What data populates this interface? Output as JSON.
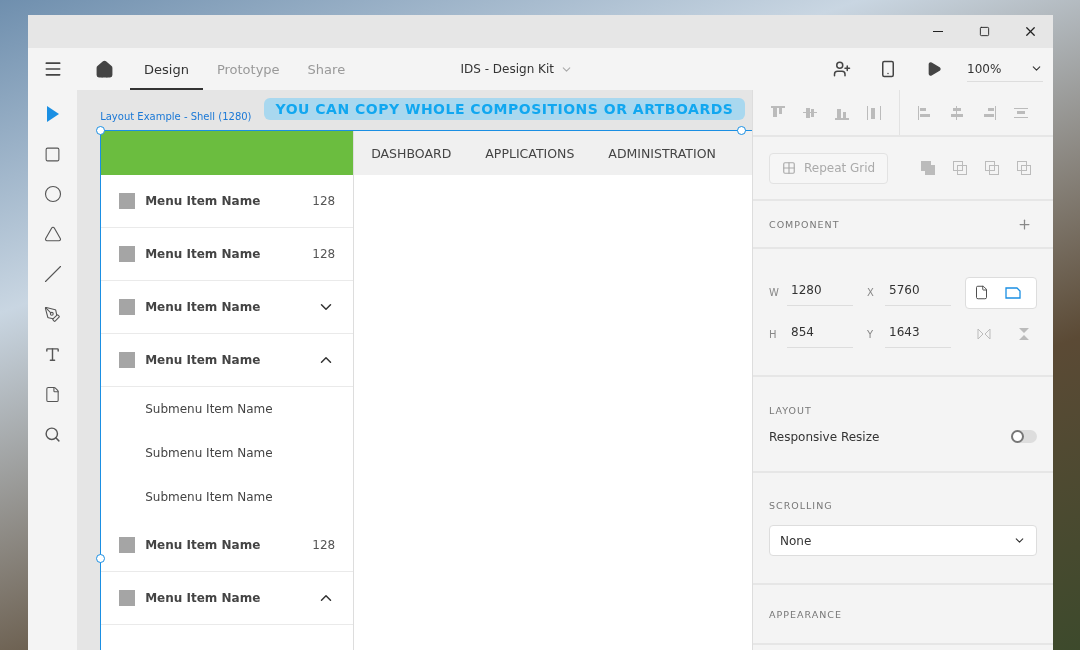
{
  "toolbar": {
    "tabs": [
      {
        "label": "Design",
        "selected": true
      },
      {
        "label": "Prototype",
        "selected": false
      },
      {
        "label": "Share",
        "selected": false
      }
    ],
    "document_title": "IDS - Design Kit",
    "zoom": "100%"
  },
  "tools": [
    {
      "kind": "select",
      "selected": true
    },
    {
      "kind": "rectangle",
      "selected": false
    },
    {
      "kind": "ellipse",
      "selected": false
    },
    {
      "kind": "polygon",
      "selected": false
    },
    {
      "kind": "line",
      "selected": false
    },
    {
      "kind": "pen",
      "selected": false
    },
    {
      "kind": "text",
      "selected": false
    },
    {
      "kind": "artboard",
      "selected": false
    },
    {
      "kind": "zoom",
      "selected": false
    }
  ],
  "canvas": {
    "artboard_label": "Layout Example - Shell (1280)",
    "banner": "YOU CAN COPY WHOLE COMPOSITIONS OR ARTBOARDS",
    "nav": [
      "DASHBOARD",
      "APPLICATIONS",
      "ADMINISTRATION"
    ],
    "menu": [
      {
        "label": "Menu Item Name",
        "kind": "count",
        "count": "128"
      },
      {
        "label": "Menu Item Name",
        "kind": "count",
        "count": "128"
      },
      {
        "label": "Menu Item Name",
        "kind": "expandable",
        "expanded": false
      },
      {
        "label": "Menu Item Name",
        "kind": "expandable",
        "expanded": true,
        "children": [
          {
            "label": "Submenu Item Name"
          },
          {
            "label": "Submenu Item Name"
          },
          {
            "label": "Submenu Item Name"
          }
        ]
      },
      {
        "label": "Menu Item Name",
        "kind": "count",
        "count": "128"
      },
      {
        "label": "Menu Item Name",
        "kind": "expandable",
        "expanded": true
      }
    ]
  },
  "panel": {
    "repeat_grid": "Repeat Grid",
    "component": "COMPONENT",
    "fields": [
      {
        "label": "W",
        "value": "1280"
      },
      {
        "label": "X",
        "value": "5760"
      },
      {
        "label": "H",
        "value": "854"
      },
      {
        "label": "Y",
        "value": "1643"
      }
    ],
    "orientation": [
      {
        "kind": "portrait",
        "selected": false
      },
      {
        "kind": "landscape",
        "selected": true
      }
    ],
    "layout": {
      "title": "LAYOUT",
      "label": "Responsive Resize",
      "on": false
    },
    "scrolling": {
      "title": "SCROLLING",
      "value": "None"
    },
    "appearance": "APPEARANCE"
  }
}
